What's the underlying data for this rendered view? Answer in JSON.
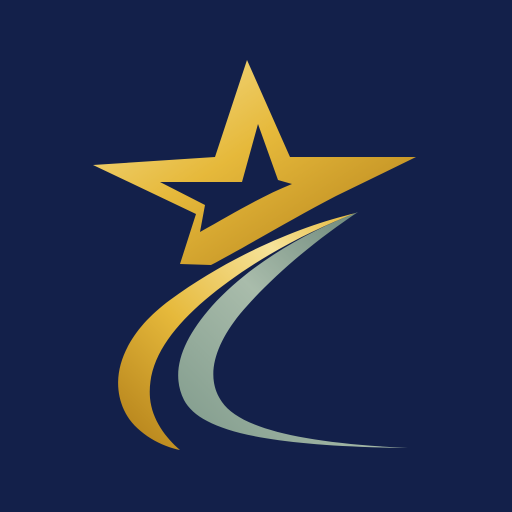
{
  "icon": {
    "name": "shooting-star-logo",
    "background_color": "#13204a",
    "colors": {
      "gold_light": "#f6e39a",
      "gold_mid": "#e6b93b",
      "gold_dark": "#b07d18",
      "teal_light": "#a9bcab",
      "teal_mid": "#7e998a",
      "teal_dark": "#5d7a6e"
    }
  }
}
